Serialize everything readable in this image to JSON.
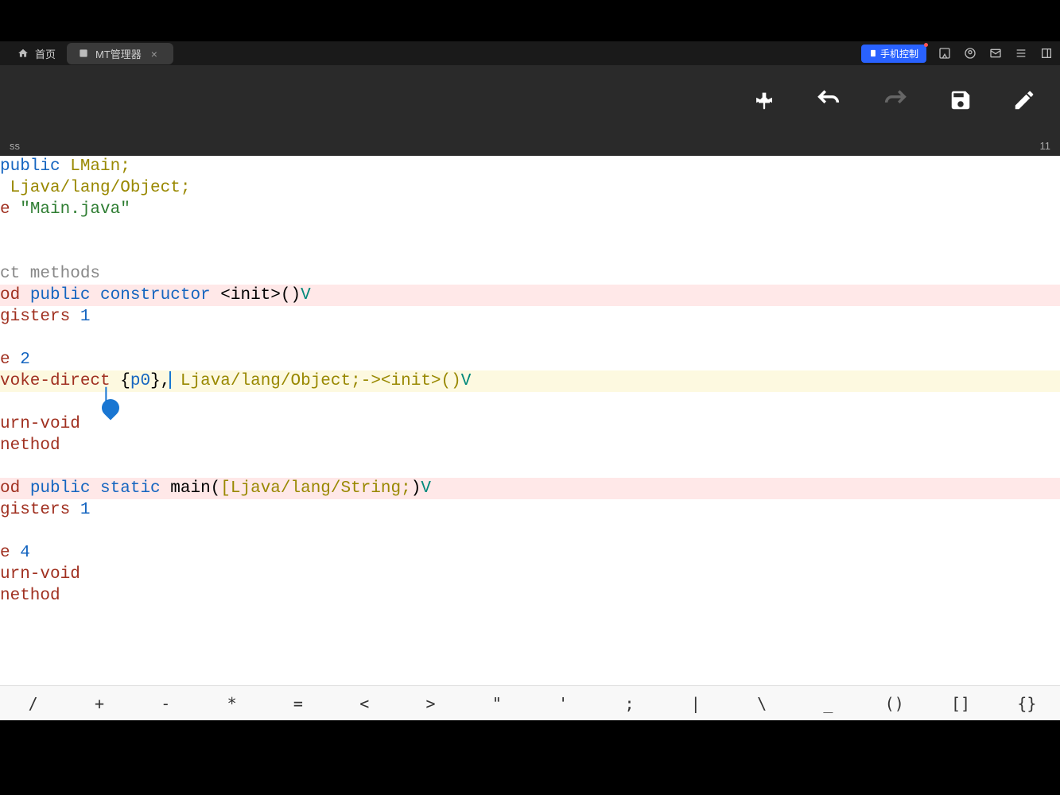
{
  "tabs": {
    "home": "首页",
    "active": "MT管理器"
  },
  "phone_control": "手机控制",
  "status": {
    "left": "ss",
    "right": "11"
  },
  "code": {
    "l1_public": "public",
    "l1_class": " LMain;",
    "l2_class": " Ljava/lang/Object;",
    "l3_e": "e ",
    "l3_file": "\"Main.java\"",
    "l5_comment": "ct methods",
    "l6_od": "od ",
    "l6_public": "public",
    "l6_constructor": " constructor",
    "l6_init": " <init>()",
    "l6_v": "V",
    "l7_reg": "gisters ",
    "l7_1": "1",
    "l9_e": "e ",
    "l9_2": "2",
    "l10_invoke": "voke-direct ",
    "l10_brace": "{",
    "l10_p0": "p0",
    "l10_brace2": "},",
    "l10_obj": " Ljava/lang/Object;-><init>()",
    "l10_v": "V",
    "l12_return": "urn-void",
    "l13_method": "nethod",
    "l15_od": "od ",
    "l15_public": "public",
    "l15_static": " static",
    "l15_main": " main(",
    "l15_str": "[Ljava/lang/String;",
    "l15_paren": ")",
    "l15_v": "V",
    "l16_reg": "gisters ",
    "l16_1": "1",
    "l18_e": "e ",
    "l18_4": "4",
    "l19_return": "urn-void",
    "l20_method": "nethod"
  },
  "symbols": [
    "/",
    "+",
    "-",
    "*",
    "=",
    "<",
    ">",
    "\"",
    "'",
    ";",
    "|",
    "\\",
    "_",
    "()",
    "[]",
    "{}"
  ]
}
